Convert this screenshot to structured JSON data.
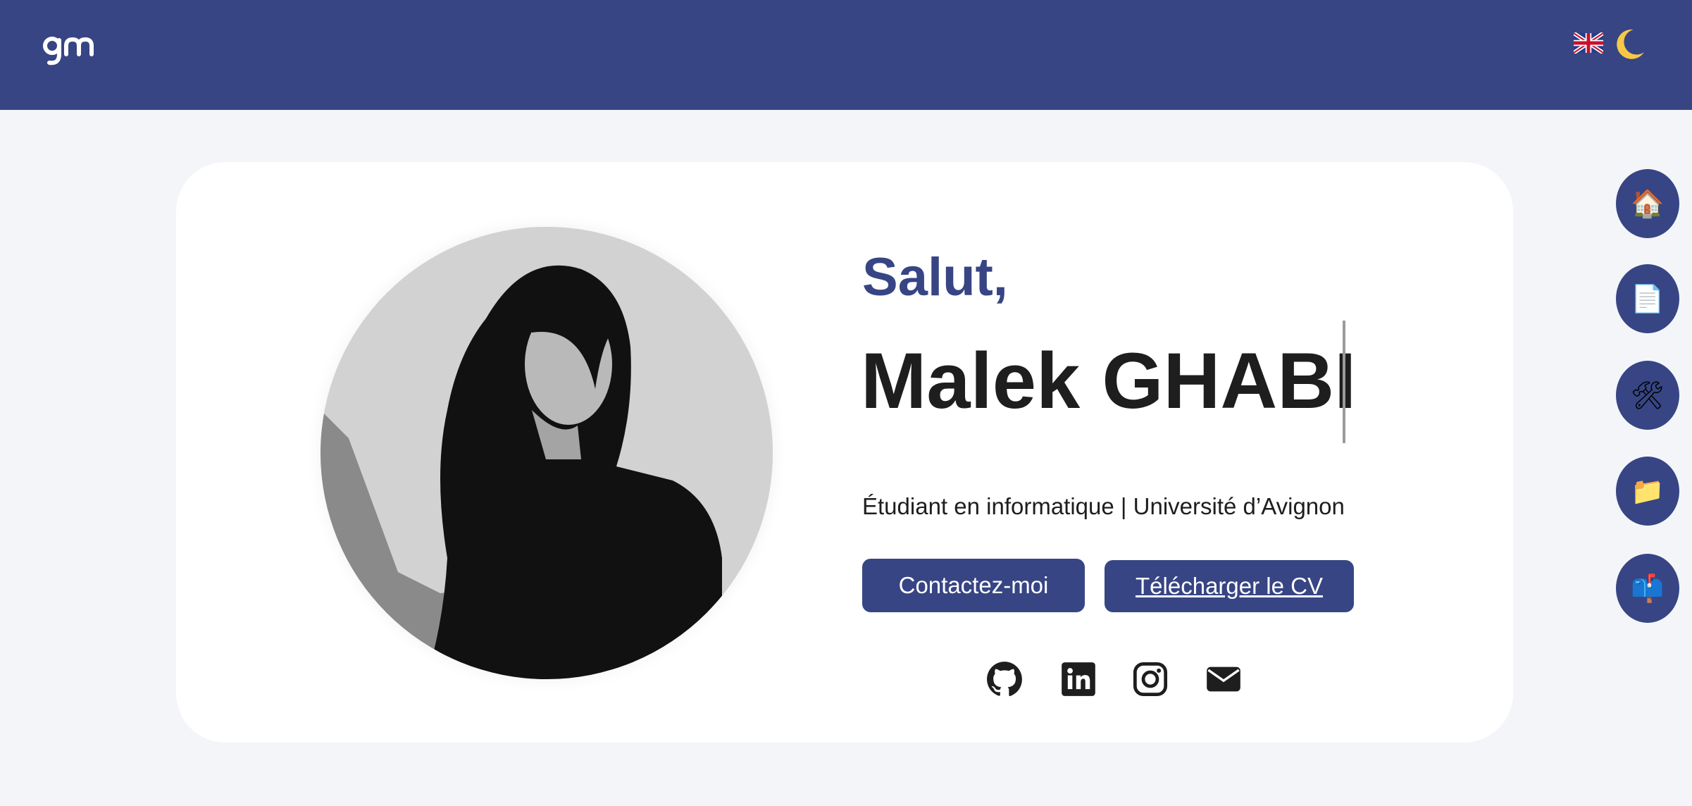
{
  "header": {
    "logo_text": "gm",
    "language_flag_icon": "uk-flag-icon",
    "theme_icon": "moon-icon"
  },
  "hero": {
    "greeting": "Salut,",
    "name": "Malek GHABI",
    "subtitle": "Étudiant en informatique | Université d’Avignon",
    "contact_button": "Contactez-moi",
    "cv_button": "Télécharger le CV"
  },
  "social": [
    {
      "icon": "github-icon"
    },
    {
      "icon": "linkedin-icon"
    },
    {
      "icon": "instagram-icon"
    },
    {
      "icon": "email-icon"
    }
  ],
  "side_nav": [
    {
      "icon": "house-icon",
      "glyph": "🏠"
    },
    {
      "icon": "document-icon",
      "glyph": "📄"
    },
    {
      "icon": "tools-icon",
      "glyph": "🛠"
    },
    {
      "icon": "folder-icon",
      "glyph": "📁"
    },
    {
      "icon": "mailbox-icon",
      "glyph": "📫"
    }
  ],
  "colors": {
    "primary": "#374584",
    "background": "#f3f5f9",
    "card": "#ffffff",
    "text": "#1e1e1e"
  }
}
